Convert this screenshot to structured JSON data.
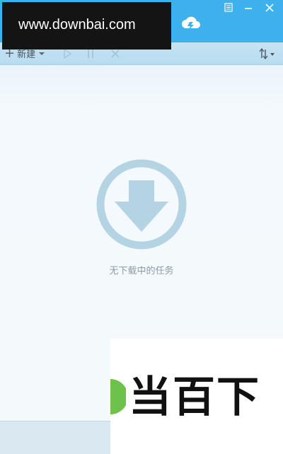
{
  "window": {
    "watermark_text": "www.downbai.com",
    "controls": [
      "menu-icon",
      "minimize-icon",
      "close-icon"
    ]
  },
  "toolbar": {
    "new_label": "新建",
    "new_icon": "plus-icon",
    "actions": [
      "play-icon",
      "pause-icon",
      "delete-icon"
    ],
    "sort_icon": "sort-icon"
  },
  "main": {
    "empty_text": "无下载中的任务",
    "empty_icon": "download-arrow-circle-icon"
  },
  "logo": {
    "text": "当百下"
  },
  "colors": {
    "titlebar": "#3eb1ed",
    "toolbar": "#c6e3f3",
    "content_bg": "#f4f9fc",
    "empty_icon": "#b4d4e4",
    "status_bar": "#d9e8f1"
  }
}
